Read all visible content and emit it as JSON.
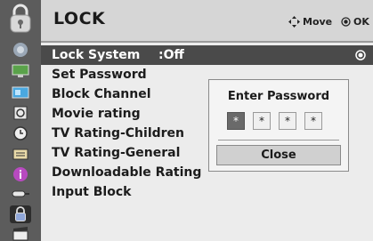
{
  "header": {
    "title": "LOCK",
    "move_hint": "Move",
    "ok_hint": "OK"
  },
  "menu": {
    "items": [
      {
        "label": "Lock System",
        "value": ":Off",
        "selected": true
      },
      {
        "label": "Set Password"
      },
      {
        "label": "Block Channel"
      },
      {
        "label": "Movie rating"
      },
      {
        "label": "TV Rating-Children"
      },
      {
        "label": "TV Rating-General"
      },
      {
        "label": "Downloadable Rating"
      },
      {
        "label": "Input Block"
      }
    ]
  },
  "sidebar": {
    "icons": [
      "picture-icon",
      "screen-icon",
      "channel-icon",
      "audio-icon",
      "time-icon",
      "option-icon",
      "info-icon",
      "input-icon",
      "lock-icon",
      "movie-icon"
    ],
    "selected": "lock-icon"
  },
  "dialog": {
    "title": "Enter Password",
    "digits": [
      "*",
      "*",
      "*",
      "*"
    ],
    "active_index": 0,
    "close_label": "Close"
  },
  "colors": {
    "selected_row": "#4a4a4a",
    "sidebar": "#5c5c5c",
    "menu_bg": "#ececec"
  }
}
